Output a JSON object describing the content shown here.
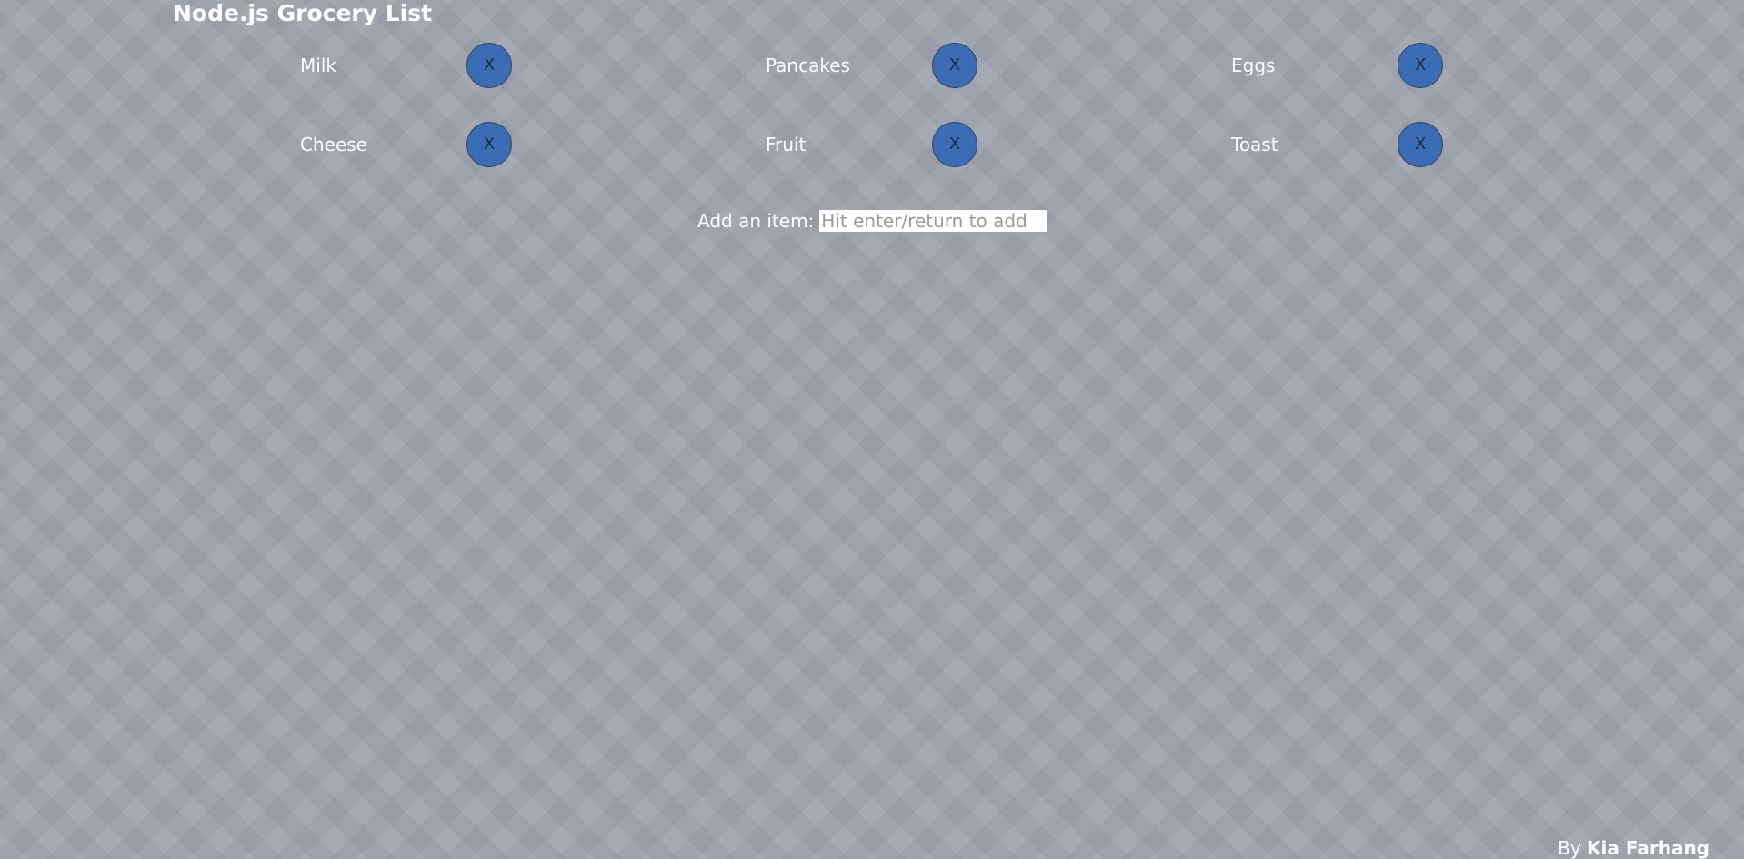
{
  "page": {
    "title": "Node.js Grocery List"
  },
  "grocery_list": {
    "items": [
      {
        "label": "Milk",
        "remove_label": "X"
      },
      {
        "label": "Pancakes",
        "remove_label": "X"
      },
      {
        "label": "Eggs",
        "remove_label": "X"
      },
      {
        "label": "Cheese",
        "remove_label": "X"
      },
      {
        "label": "Fruit",
        "remove_label": "X"
      },
      {
        "label": "Toast",
        "remove_label": "X"
      }
    ]
  },
  "add_item": {
    "label": "Add an item:",
    "value": "",
    "placeholder": "Hit enter/return to add"
  },
  "footer": {
    "prefix": "By",
    "author": "Kia Farhang"
  },
  "colors": {
    "background": "#9ea3ad",
    "remove_button": "#3a6db5",
    "text": "#ffffff"
  }
}
